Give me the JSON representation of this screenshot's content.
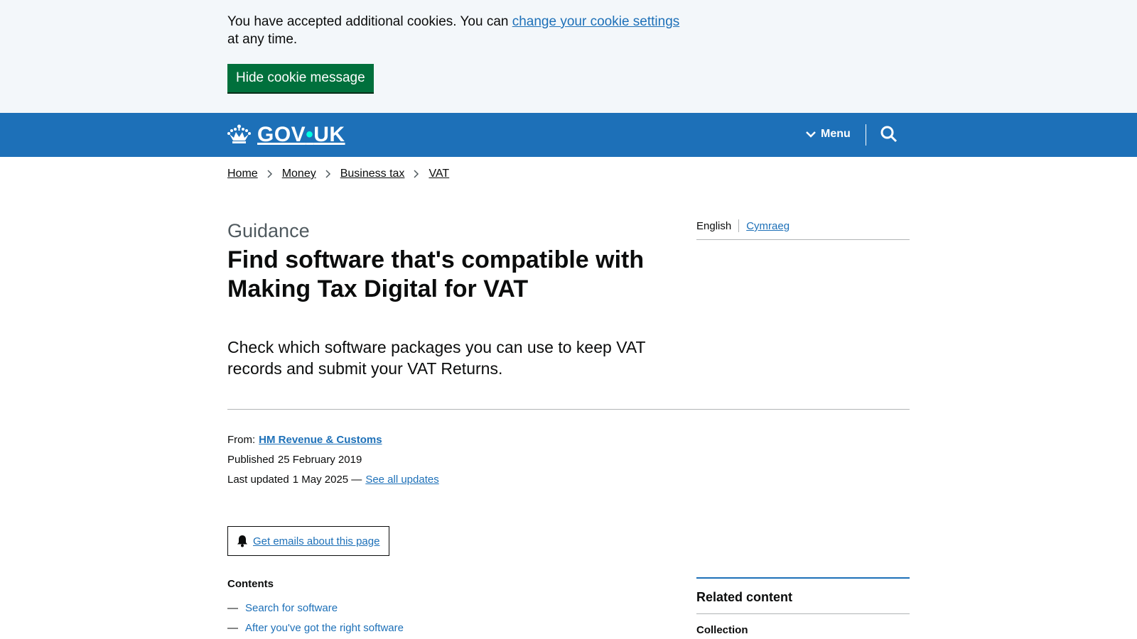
{
  "cookie": {
    "text_before": "You have accepted additional cookies. You can ",
    "link_text": "change your cookie settings",
    "text_after": " at any time.",
    "hide_label": "Hide cookie message"
  },
  "header": {
    "logo_gov": "GOV",
    "logo_dot": "•",
    "logo_uk": "UK",
    "menu_label": "Menu",
    "search_icon": "search-icon",
    "crown_icon": "crown-icon"
  },
  "breadcrumbs": [
    "Home",
    "Money",
    "Business tax",
    "VAT"
  ],
  "page": {
    "caption": "Guidance",
    "title": "Find software that's compatible with Making Tax Digital for VAT",
    "lead": "Check which software packages you can use to keep VAT records and submit your VAT Returns."
  },
  "languages": {
    "current": "English",
    "other": "Cymraeg"
  },
  "meta": {
    "from_label": "From:",
    "organisation": "HM Revenue & Customs",
    "published_label": "Published",
    "published_date": "25 February 2019",
    "updated_label": "Last updated",
    "updated_date": "1 May 2025 —",
    "see_updates": "See all updates"
  },
  "email_signup": {
    "label": "Get emails about this page",
    "icon": "bell-icon"
  },
  "contents": {
    "title": "Contents",
    "items": [
      "Search for software",
      "After you've got the right software"
    ]
  },
  "related": {
    "title": "Related content",
    "subheading": "Collection"
  },
  "colors": {
    "brand_blue": "#1d70b8",
    "button_green": "#00703c",
    "banner_bg": "#f3f7fa"
  }
}
